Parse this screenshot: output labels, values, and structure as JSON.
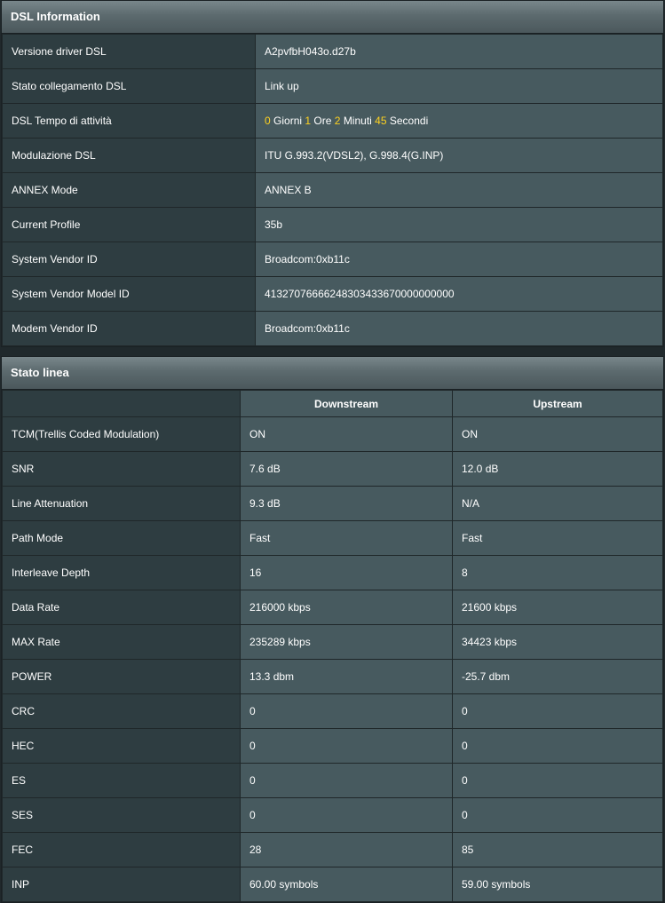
{
  "dsl_info": {
    "title": "DSL Information",
    "rows": [
      {
        "label": "Versione driver DSL",
        "value": "A2pvfbH043o.d27b"
      },
      {
        "label": "Stato collegamento DSL",
        "value": "Link up"
      },
      {
        "label": "DSL Tempo di attività",
        "uptime": {
          "days": "0",
          "days_unit": "Giorni",
          "hours": "1",
          "hours_unit": "Ore",
          "minutes": "2",
          "minutes_unit": "Minuti",
          "seconds": "45",
          "seconds_unit": "Secondi"
        }
      },
      {
        "label": "Modulazione DSL",
        "value": "ITU G.993.2(VDSL2), G.998.4(G.INP)"
      },
      {
        "label": "ANNEX Mode",
        "value": "ANNEX B"
      },
      {
        "label": "Current Profile",
        "value": "35b"
      },
      {
        "label": "System Vendor ID",
        "value": "Broadcom:0xb11c"
      },
      {
        "label": "System Vendor Model ID",
        "value": "41327076666248303433670000000000"
      },
      {
        "label": "Modem Vendor ID",
        "value": "Broadcom:0xb11c"
      }
    ]
  },
  "line_status": {
    "title": "Stato linea",
    "columns": [
      "Downstream",
      "Upstream"
    ],
    "rows": [
      {
        "label": "TCM(Trellis Coded Modulation)",
        "down": "ON",
        "up": "ON"
      },
      {
        "label": "SNR",
        "down": "7.6 dB",
        "up": "12.0 dB"
      },
      {
        "label": "Line Attenuation",
        "down": "9.3 dB",
        "up": "N/A"
      },
      {
        "label": "Path Mode",
        "down": "Fast",
        "up": "Fast"
      },
      {
        "label": "Interleave Depth",
        "down": "16",
        "up": "8"
      },
      {
        "label": "Data Rate",
        "down": "216000 kbps",
        "up": "21600 kbps"
      },
      {
        "label": "MAX Rate",
        "down": "235289 kbps",
        "up": "34423 kbps"
      },
      {
        "label": "POWER",
        "down": "13.3 dbm",
        "up": "-25.7 dbm"
      },
      {
        "label": "CRC",
        "down": "0",
        "up": "0"
      },
      {
        "label": "HEC",
        "down": "0",
        "up": "0"
      },
      {
        "label": "ES",
        "down": "0",
        "up": "0"
      },
      {
        "label": "SES",
        "down": "0",
        "up": "0"
      },
      {
        "label": "FEC",
        "down": "28",
        "up": "85"
      },
      {
        "label": "INP",
        "down": "60.00 symbols",
        "up": "59.00 symbols"
      }
    ]
  },
  "colors": {
    "highlight": "#ffd21f",
    "label_cell": "#2e3d41",
    "value_cell": "#475a5f"
  }
}
